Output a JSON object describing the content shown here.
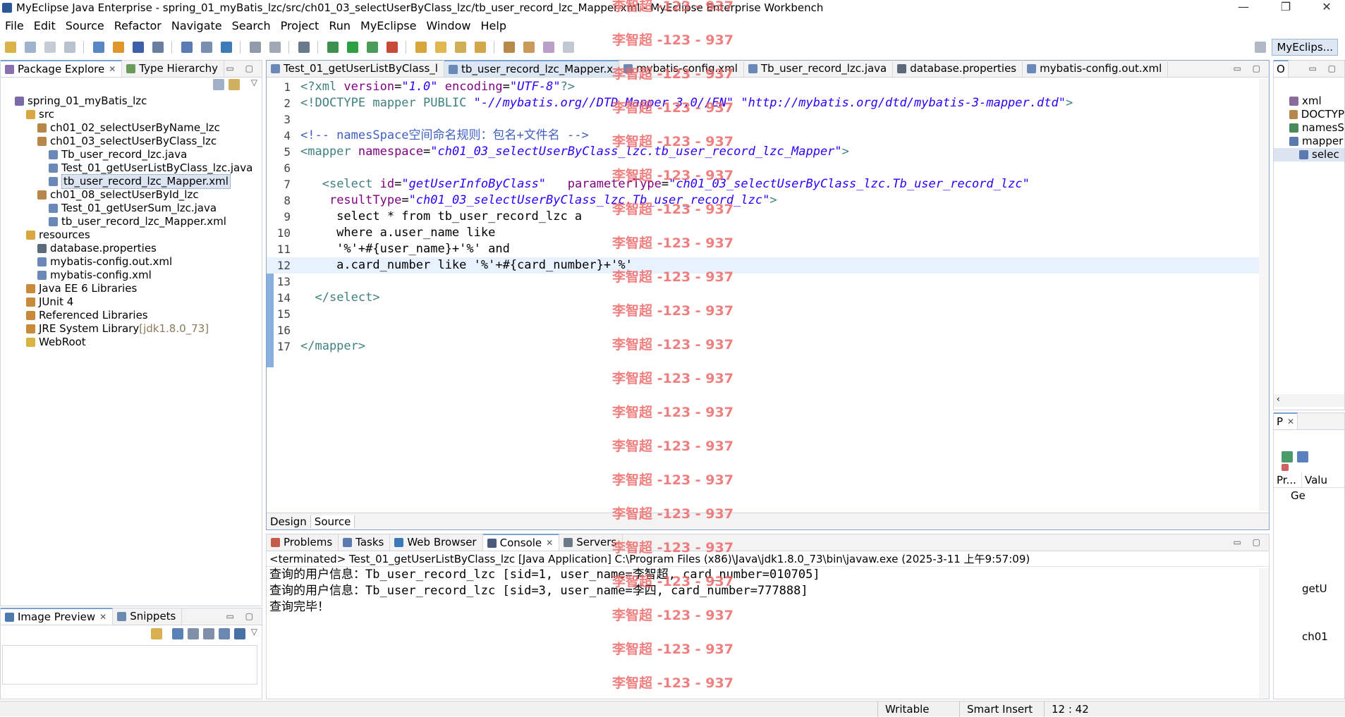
{
  "window": {
    "title": "MyEclipse Java Enterprise - spring_01_myBatis_lzc/src/ch01_03_selectUserByClass_lzc/tb_user_record_lzc_Mapper.xml - MyEclipse Enterprise Workbench",
    "minimize": "—",
    "maximize": "❐",
    "close": "✕"
  },
  "menu": [
    "File",
    "Edit",
    "Source",
    "Refactor",
    "Navigate",
    "Search",
    "Project",
    "Run",
    "MyEclipse",
    "Window",
    "Help"
  ],
  "perspective": {
    "label": "MyEclips..."
  },
  "package_explorer": {
    "tabs": [
      {
        "label": "Package Explore"
      },
      {
        "label": "Type Hierarchy"
      }
    ],
    "tree": [
      {
        "label": "spring_01_myBatis_lzc",
        "icon": "project-icon",
        "depth": 0
      },
      {
        "label": "src",
        "icon": "source-folder-icon",
        "depth": 1
      },
      {
        "label": "ch01_02_selectUserByName_lzc",
        "icon": "package-icon",
        "depth": 2
      },
      {
        "label": "ch01_03_selectUserByClass_lzc",
        "icon": "package-icon",
        "depth": 2
      },
      {
        "label": "Tb_user_record_lzc.java",
        "icon": "java-file-icon",
        "depth": 3
      },
      {
        "label": "Test_01_getUserListByClass_lzc.java",
        "icon": "java-file-icon",
        "depth": 3
      },
      {
        "label": "tb_user_record_lzc_Mapper.xml",
        "icon": "xml-file-icon",
        "depth": 3,
        "selected": true
      },
      {
        "label": "ch01_08_selectUserById_lzc",
        "icon": "package-icon",
        "depth": 2
      },
      {
        "label": "Test_01_getUserSum_lzc.java",
        "icon": "java-file-icon",
        "depth": 3
      },
      {
        "label": "tb_user_record_lzc_Mapper.xml",
        "icon": "xml-file-icon",
        "depth": 3
      },
      {
        "label": "resources",
        "icon": "source-folder-icon",
        "depth": 1
      },
      {
        "label": "database.properties",
        "icon": "properties-file-icon",
        "depth": 2
      },
      {
        "label": "mybatis-config.out.xml",
        "icon": "xml-file-icon",
        "depth": 2
      },
      {
        "label": "mybatis-config.xml",
        "icon": "xml-file-icon",
        "depth": 2
      },
      {
        "label": "Java EE 6 Libraries",
        "icon": "library-icon",
        "depth": 1
      },
      {
        "label": "JUnit 4",
        "icon": "library-icon",
        "depth": 1
      },
      {
        "label": "Referenced Libraries",
        "icon": "library-icon",
        "depth": 1
      },
      {
        "label": "JRE System Library",
        "suffix": "[jdk1.8.0_73]",
        "icon": "library-icon",
        "depth": 1
      },
      {
        "label": "WebRoot",
        "icon": "folder-icon",
        "depth": 1
      }
    ]
  },
  "image_preview": {
    "tabs": [
      {
        "label": "Image Preview"
      },
      {
        "label": "Snippets"
      }
    ]
  },
  "editor": {
    "tabs": [
      {
        "label": "Test_01_getUserListByClass_l",
        "active": false
      },
      {
        "label": "tb_user_record_lzc_Mapper.x",
        "active": true
      },
      {
        "label": "mybatis-config.xml",
        "active": false
      },
      {
        "label": "Tb_user_record_lzc.java",
        "active": false
      },
      {
        "label": "database.properties",
        "active": false
      },
      {
        "label": "mybatis-config.out.xml",
        "active": false
      }
    ],
    "lines": [
      {
        "n": "1",
        "segs": [
          [
            "pi",
            "<?xml "
          ],
          [
            "attr",
            "version"
          ],
          [
            "plain",
            "="
          ],
          [
            "str",
            "\"1.0\""
          ],
          [
            "plain",
            " "
          ],
          [
            "attr",
            "encoding"
          ],
          [
            "plain",
            "="
          ],
          [
            "str",
            "\"UTF-8\""
          ],
          [
            "pi",
            "?>"
          ]
        ]
      },
      {
        "n": "2",
        "segs": [
          [
            "pi",
            "<!DOCTYPE mapper PUBLIC "
          ],
          [
            "str",
            "\"-//mybatis.org//DTD Mapper 3.0//EN\""
          ],
          [
            "plain",
            " "
          ],
          [
            "str",
            "\"http://mybatis.org/dtd/mybatis-3-mapper.dtd\""
          ],
          [
            "pi",
            ">"
          ]
        ]
      },
      {
        "n": "3",
        "segs": []
      },
      {
        "n": "4",
        "segs": [
          [
            "cmt",
            "<!-- namesSpace空间命名规则：包名+文件名 -->"
          ]
        ]
      },
      {
        "n": "5",
        "segs": [
          [
            "tag",
            "<mapper "
          ],
          [
            "attr",
            "namespace"
          ],
          [
            "plain",
            "="
          ],
          [
            "str",
            "\"ch01_03_selectUserByClass_lzc.tb_user_record_lzc_Mapper\""
          ],
          [
            "tag",
            ">"
          ]
        ]
      },
      {
        "n": "6",
        "segs": []
      },
      {
        "n": "7",
        "segs": [
          [
            "plain",
            "   "
          ],
          [
            "tag",
            "<select "
          ],
          [
            "attr",
            "id"
          ],
          [
            "plain",
            "="
          ],
          [
            "str",
            "\"getUserInfoByClass\""
          ],
          [
            "plain",
            "   "
          ],
          [
            "attr",
            "parameterType"
          ],
          [
            "plain",
            "="
          ],
          [
            "str",
            "\"ch01_03_selectUserByClass_lzc.Tb_user_record_lzc\""
          ]
        ]
      },
      {
        "n": "8",
        "segs": [
          [
            "plain",
            "    "
          ],
          [
            "attr",
            "resultType"
          ],
          [
            "plain",
            "="
          ],
          [
            "str",
            "\"ch01_03_selectUserByClass_lzc.Tb_user_record_lzc\""
          ],
          [
            "tag",
            ">"
          ]
        ]
      },
      {
        "n": "9",
        "segs": [
          [
            "plain",
            "     select * from tb_user_record_lzc a"
          ]
        ]
      },
      {
        "n": "10",
        "segs": [
          [
            "plain",
            "     where a.user_name like"
          ]
        ]
      },
      {
        "n": "11",
        "segs": [
          [
            "plain",
            "     '%'+#{user_name}+'%' and"
          ]
        ]
      },
      {
        "n": "12",
        "segs": [
          [
            "plain",
            "     a.card_number like '%'+#{card_number}+'%'"
          ]
        ],
        "current": true
      },
      {
        "n": "13",
        "segs": []
      },
      {
        "n": "14",
        "segs": [
          [
            "plain",
            "  "
          ],
          [
            "tag",
            "</select>"
          ]
        ]
      },
      {
        "n": "15",
        "segs": []
      },
      {
        "n": "16",
        "segs": []
      },
      {
        "n": "17",
        "segs": [
          [
            "tag",
            "</mapper>"
          ]
        ]
      }
    ],
    "bottom_tabs": [
      {
        "label": "Design"
      },
      {
        "label": "Source",
        "active": true
      }
    ]
  },
  "outline": {
    "tab": "O",
    "items": [
      {
        "label": "xml",
        "icon": "pi-icon"
      },
      {
        "label": "DOCTYP",
        "icon": "doctype-icon"
      },
      {
        "label": "namesS",
        "icon": "comment-icon"
      },
      {
        "label": "mapper",
        "icon": "element-icon"
      },
      {
        "label": "selec",
        "icon": "element-icon"
      }
    ]
  },
  "properties": {
    "tab": "P",
    "col1": "Pr...",
    "col2": "Valu",
    "row1": "Ge",
    "side_items": [
      "getU",
      "ch01"
    ]
  },
  "console": {
    "tabs": [
      {
        "label": "Problems"
      },
      {
        "label": "Tasks"
      },
      {
        "label": "Web Browser"
      },
      {
        "label": "Console",
        "active": true
      },
      {
        "label": "Servers"
      }
    ],
    "header": "<terminated> Test_01_getUserListByClass_lzc [Java Application] C:\\Program Files (x86)\\Java\\jdk1.8.0_73\\bin\\javaw.exe (2025-3-11 上午9:57:09)",
    "lines": [
      "查询的用户信息：Tb_user_record_lzc [sid=1, user_name=李智超, card_number=010705]",
      "查询的用户信息：Tb_user_record_lzc [sid=3, user_name=李四, card_number=777888]",
      "查询完毕！"
    ]
  },
  "statusbar": {
    "writable": "Writable",
    "insert_mode": "Smart Insert",
    "position": "12 : 42"
  },
  "watermark": "李智超 -123 - 937"
}
